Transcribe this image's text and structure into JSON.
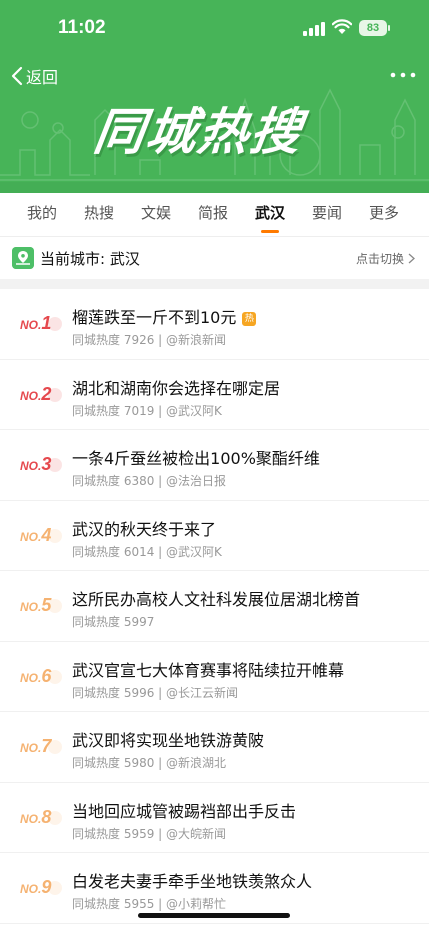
{
  "status": {
    "time": "11:02",
    "battery": "83"
  },
  "header": {
    "back_label": "返回",
    "banner_title": "同城热搜"
  },
  "tabs": [
    {
      "label": "我的",
      "active": false
    },
    {
      "label": "热搜",
      "active": false
    },
    {
      "label": "文娱",
      "active": false
    },
    {
      "label": "简报",
      "active": false
    },
    {
      "label": "武汉",
      "active": true
    },
    {
      "label": "要闻",
      "active": false
    },
    {
      "label": "更多",
      "active": false
    }
  ],
  "city": {
    "label": "当前城市: 武汉",
    "switch_label": "点击切换"
  },
  "list": [
    {
      "rank_prefix": "NO.",
      "rank": "1",
      "title": "榴莲跌至一斤不到10元",
      "badge": "热",
      "meta": "同城热度 7926 | @新浪新闻"
    },
    {
      "rank_prefix": "NO.",
      "rank": "2",
      "title": "湖北和湖南你会选择在哪定居",
      "meta": "同城热度 7019 | @武汉阿K"
    },
    {
      "rank_prefix": "NO.",
      "rank": "3",
      "title": "一条4斤蚕丝被检出100%聚酯纤维",
      "meta": "同城热度 6380 | @法治日报"
    },
    {
      "rank_prefix": "NO.",
      "rank": "4",
      "title": "武汉的秋天终于来了",
      "meta": "同城热度 6014 | @武汉阿K"
    },
    {
      "rank_prefix": "NO.",
      "rank": "5",
      "title": "这所民办高校人文社科发展位居湖北榜首",
      "meta": "同城热度 5997"
    },
    {
      "rank_prefix": "NO.",
      "rank": "6",
      "title": "武汉官宣七大体育赛事将陆续拉开帷幕",
      "meta": "同城热度 5996 | @长江云新闻"
    },
    {
      "rank_prefix": "NO.",
      "rank": "7",
      "title": "武汉即将实现坐地铁游黄陂",
      "meta": "同城热度 5980 | @新浪湖北"
    },
    {
      "rank_prefix": "NO.",
      "rank": "8",
      "title": "当地回应城管被踢裆部出手反击",
      "meta": "同城热度 5959 | @大皖新闻"
    },
    {
      "rank_prefix": "NO.",
      "rank": "9",
      "title": "白发老夫妻手牵手坐地铁羡煞众人",
      "meta": "同城热度 5955 | @小莉帮忙"
    }
  ],
  "colors": {
    "header_green": "#47b458",
    "tab_indicator": "#ff7a00",
    "rank_top": "#e5484d",
    "rank_rest": "#f5b271",
    "hot_badge": "#f6a623"
  }
}
